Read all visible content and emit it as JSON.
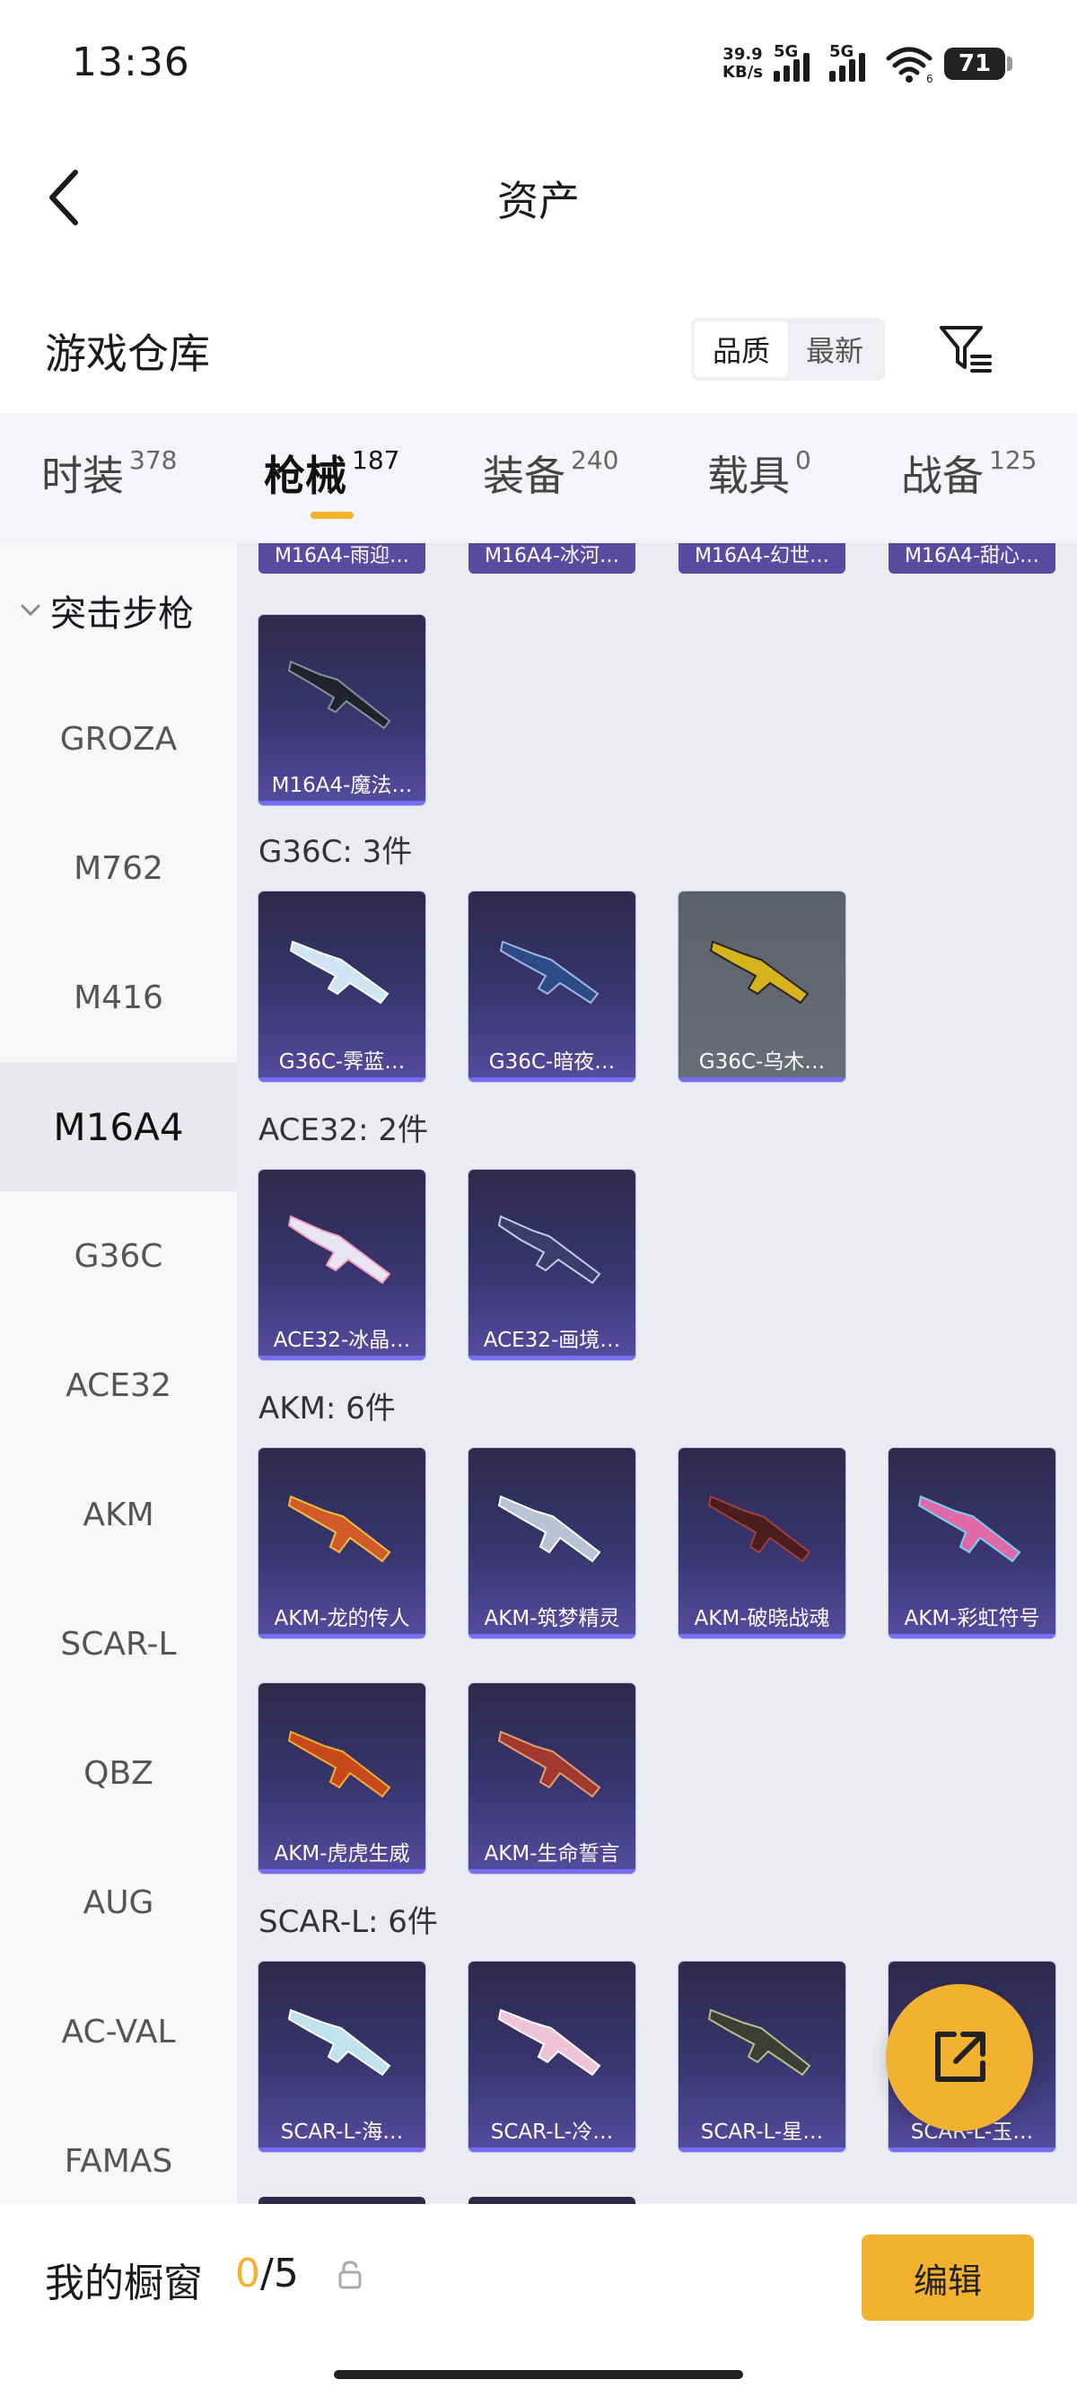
{
  "status_bar": {
    "time": "13:36",
    "net_speed_value": "39.9",
    "net_speed_unit": "KB/s",
    "sim1_label": "5G",
    "sim2_label": "5G",
    "wifi_sub": "6",
    "battery": "71"
  },
  "nav": {
    "title": "资产"
  },
  "section": {
    "title": "游戏仓库",
    "sort_options": [
      "品质",
      "最新"
    ],
    "sort_active": "品质"
  },
  "tabs": [
    {
      "label": "时装",
      "count": "378"
    },
    {
      "label": "枪械",
      "count": "187",
      "active": true
    },
    {
      "label": "装备",
      "count": "240"
    },
    {
      "label": "载具",
      "count": "0"
    },
    {
      "label": "战备",
      "count": "125"
    }
  ],
  "sidebar": {
    "category": "突击步枪",
    "items": [
      "GROZA",
      "M762",
      "M416",
      "M16A4",
      "G36C",
      "ACE32",
      "AKM",
      "SCAR-L",
      "QBZ",
      "AUG",
      "AC-VAL",
      "FAMAS"
    ],
    "active": "M16A4"
  },
  "main": {
    "top_partial_cards": [
      "M16A4-雨迎…",
      "M16A4-冰河…",
      "M16A4-幻世…",
      "M16A4-甜心…"
    ],
    "m16_cards": [
      "M16A4-魔法…"
    ],
    "groups": [
      {
        "label": "G36C: 3件",
        "cards": [
          "G36C-霁蓝…",
          "G36C-暗夜…",
          "G36C-乌木…"
        ]
      },
      {
        "label": "ACE32: 2件",
        "cards": [
          "ACE32-冰晶…",
          "ACE32-画境…"
        ]
      },
      {
        "label": "AKM: 6件",
        "cards": [
          "AKM-龙的传人",
          "AKM-筑梦精灵",
          "AKM-破晓战魂",
          "AKM-彩虹符号",
          "AKM-虎虎生威",
          "AKM-生命誓言"
        ]
      },
      {
        "label": "SCAR-L: 6件",
        "cards": [
          "SCAR-L-海…",
          "SCAR-L-冷…",
          "SCAR-L-星…",
          "SCAR-L-玉…"
        ]
      }
    ]
  },
  "bottom": {
    "showcase_label": "我的橱窗",
    "showcase_current": "0",
    "showcase_total": "/5",
    "edit_label": "编辑"
  },
  "icons": {
    "back": "chevron-left-icon",
    "filter": "filter-icon",
    "share": "share-external-icon",
    "lock": "lock-icon",
    "category_toggle": "chevron-down-icon"
  },
  "colors": {
    "accent": "#f2b230",
    "card_bg": "#3a3470",
    "card_gray": "#6a6d75"
  }
}
